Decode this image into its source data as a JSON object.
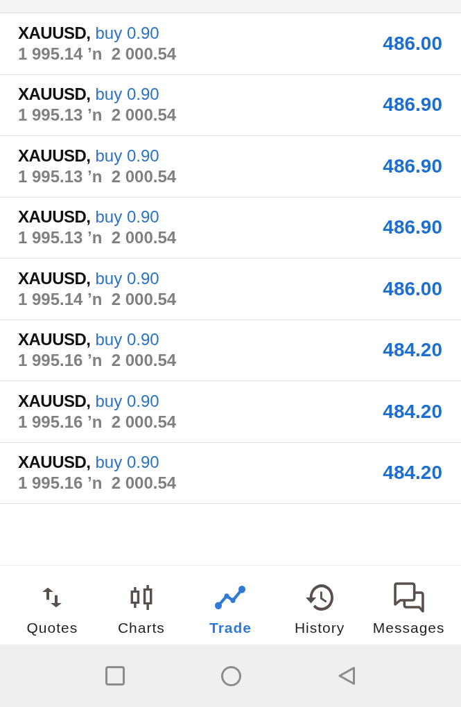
{
  "positions": [
    {
      "symbol": "XAUUSD,",
      "order": "buy 0.90",
      "prices": "1 995.14 ’n  2 000.54",
      "profit": "486.00"
    },
    {
      "symbol": "XAUUSD,",
      "order": "buy 0.90",
      "prices": "1 995.13 ’n  2 000.54",
      "profit": "486.90"
    },
    {
      "symbol": "XAUUSD,",
      "order": "buy 0.90",
      "prices": "1 995.13 ’n  2 000.54",
      "profit": "486.90"
    },
    {
      "symbol": "XAUUSD,",
      "order": "buy 0.90",
      "prices": "1 995.13 ’n  2 000.54",
      "profit": "486.90"
    },
    {
      "symbol": "XAUUSD,",
      "order": "buy 0.90",
      "prices": "1 995.14 ’n  2 000.54",
      "profit": "486.00"
    },
    {
      "symbol": "XAUUSD,",
      "order": "buy 0.90",
      "prices": "1 995.16 ’n  2 000.54",
      "profit": "484.20"
    },
    {
      "symbol": "XAUUSD,",
      "order": "buy 0.90",
      "prices": "1 995.16 ’n  2 000.54",
      "profit": "484.20"
    },
    {
      "symbol": "XAUUSD,",
      "order": "buy 0.90",
      "prices": "1 995.16 ’n  2 000.54",
      "profit": "484.20"
    }
  ],
  "bottom_nav": [
    {
      "label": "Quotes",
      "selected": false
    },
    {
      "label": "Charts",
      "selected": false
    },
    {
      "label": "Trade",
      "selected": true
    },
    {
      "label": "History",
      "selected": false
    },
    {
      "label": "Messages",
      "selected": false
    }
  ]
}
